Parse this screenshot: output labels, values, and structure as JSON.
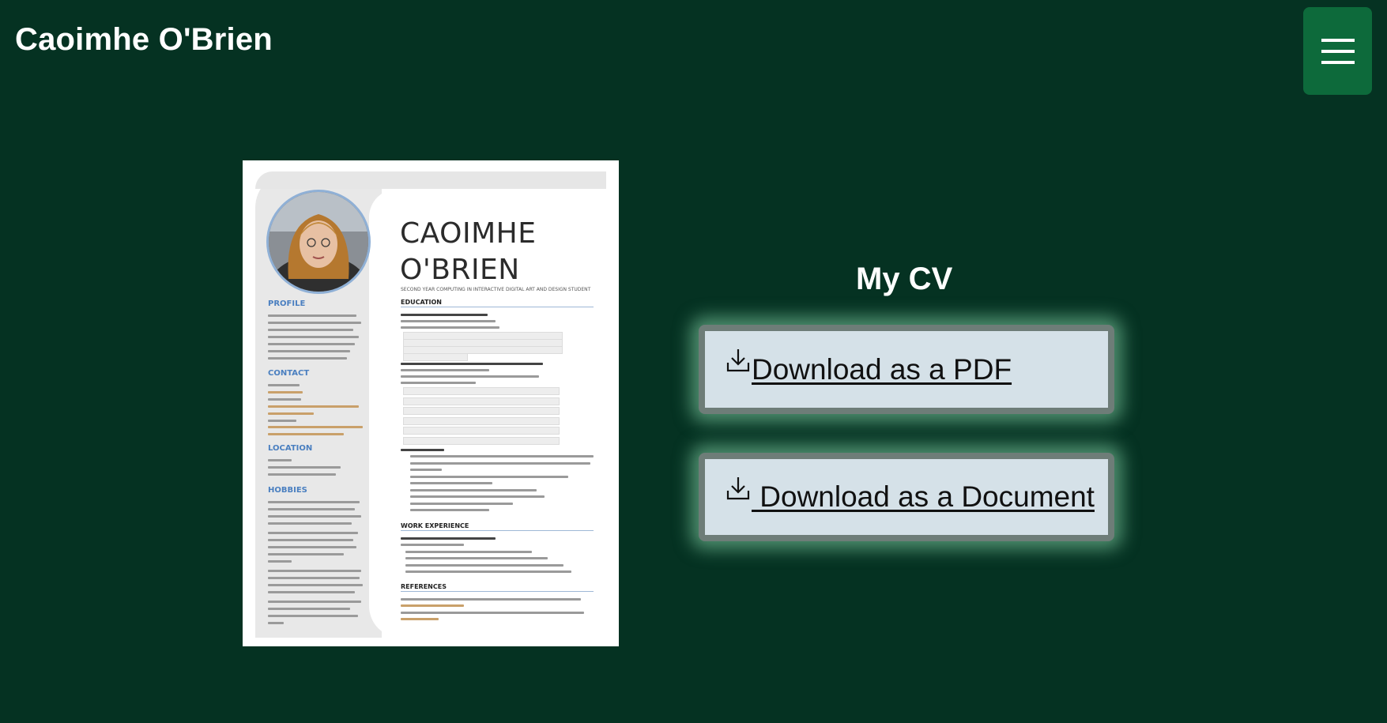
{
  "header": {
    "site_title": "Caoimhe O'Brien",
    "menu_icon": "hamburger-menu-icon"
  },
  "cv_preview": {
    "name_line1": "CAOIMHE",
    "name_line2": "O'BRIEN",
    "tagline": "SECOND YEAR COMPUTING IN INTERACTIVE DIGITAL ART AND DESIGN STUDENT",
    "left_headings": [
      "PROFILE",
      "CONTACT",
      "LOCATION",
      "HOBBIES"
    ],
    "right_headings": [
      "EDUCATION",
      "WORK EXPERIENCE",
      "REFERENCES"
    ]
  },
  "main": {
    "title": "My CV",
    "buttons": [
      {
        "label": "Download as a PDF",
        "icon": "download-icon"
      },
      {
        "label": " Download as a Document",
        "icon": "download-icon"
      }
    ]
  },
  "colors": {
    "background": "#053222",
    "menu_button": "#0d6a3b",
    "button_bg": "#d5e1e8",
    "button_border": "#6e7d78",
    "button_glow": "#8cdcaf"
  }
}
